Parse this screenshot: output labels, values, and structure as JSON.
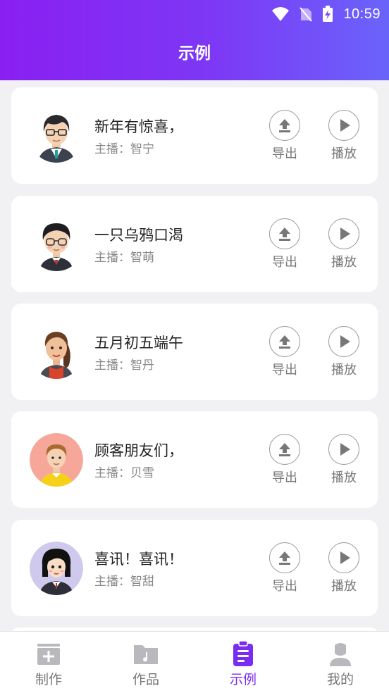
{
  "status_bar": {
    "time": "10:59"
  },
  "header": {
    "title": "示例"
  },
  "items": [
    {
      "title": "新年有惊喜，",
      "anchor": "主播：智宁",
      "avatar": "man-glasses-avatar"
    },
    {
      "title": "一只乌鸦口渴",
      "anchor": "主播：智萌",
      "avatar": "boy-glasses-avatar"
    },
    {
      "title": "五月初五端午",
      "anchor": "主播：智丹",
      "avatar": "woman-ponytail-avatar"
    },
    {
      "title": "顾客朋友们，",
      "anchor": "主播：贝雪",
      "avatar": "boy-pink-circle-avatar"
    },
    {
      "title": "喜讯！喜讯！",
      "anchor": "主播：智甜",
      "avatar": "girl-bob-avatar"
    }
  ],
  "actions": {
    "export": "导出",
    "play": "播放"
  },
  "tabs": [
    {
      "label": "制作",
      "icon": "add-box-icon"
    },
    {
      "label": "作品",
      "icon": "folder-music-icon"
    },
    {
      "label": "示例",
      "icon": "clipboard-list-icon",
      "active": true
    },
    {
      "label": "我的",
      "icon": "user-icon"
    }
  ],
  "colors": {
    "accent": "#7a2cf2",
    "header_start": "#8a1ff2",
    "header_end": "#6a64fb"
  }
}
